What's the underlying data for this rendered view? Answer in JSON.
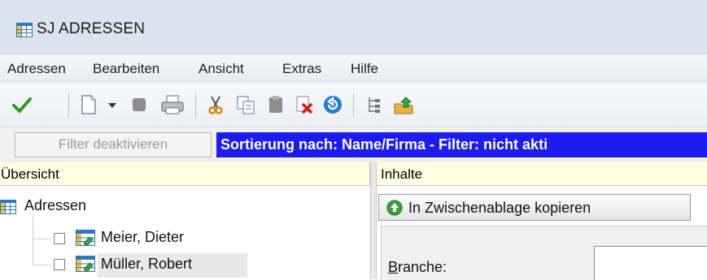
{
  "window": {
    "title": "SJ ADRESSEN",
    "app_icon": "table-icon"
  },
  "menu": [
    "Adressen",
    "Bearbeiten",
    "Ansicht",
    "Extras",
    "Hilfe"
  ],
  "toolbar": {
    "icons": [
      "check-icon",
      "new-document-icon",
      "dropdown-arrow-icon",
      "stop-icon",
      "print-icon",
      "cut-icon",
      "copy-icon",
      "paste-icon",
      "delete-icon",
      "undo-icon",
      "tree-icon",
      "export-icon"
    ]
  },
  "filter": {
    "button_label": "Filter deaktivieren",
    "status_text": "Sortierung nach: Name/Firma - Filter: nicht akti"
  },
  "left_panel": {
    "header": "Übersicht",
    "root": {
      "label": "Adressen"
    },
    "items": [
      {
        "label": "Meier, Dieter"
      },
      {
        "label": "Müller, Robert"
      }
    ]
  },
  "right_panel": {
    "header": "Inhalte",
    "copy_button_label": "In Zwischenablage kopieren",
    "field_label_first": "B",
    "field_label_rest": "ranche:",
    "field_value": ""
  },
  "colors": {
    "status_bg": "#1c1cf0",
    "header_bg": "#ffffe1",
    "titlebar_bg": "#dbe3ee"
  }
}
